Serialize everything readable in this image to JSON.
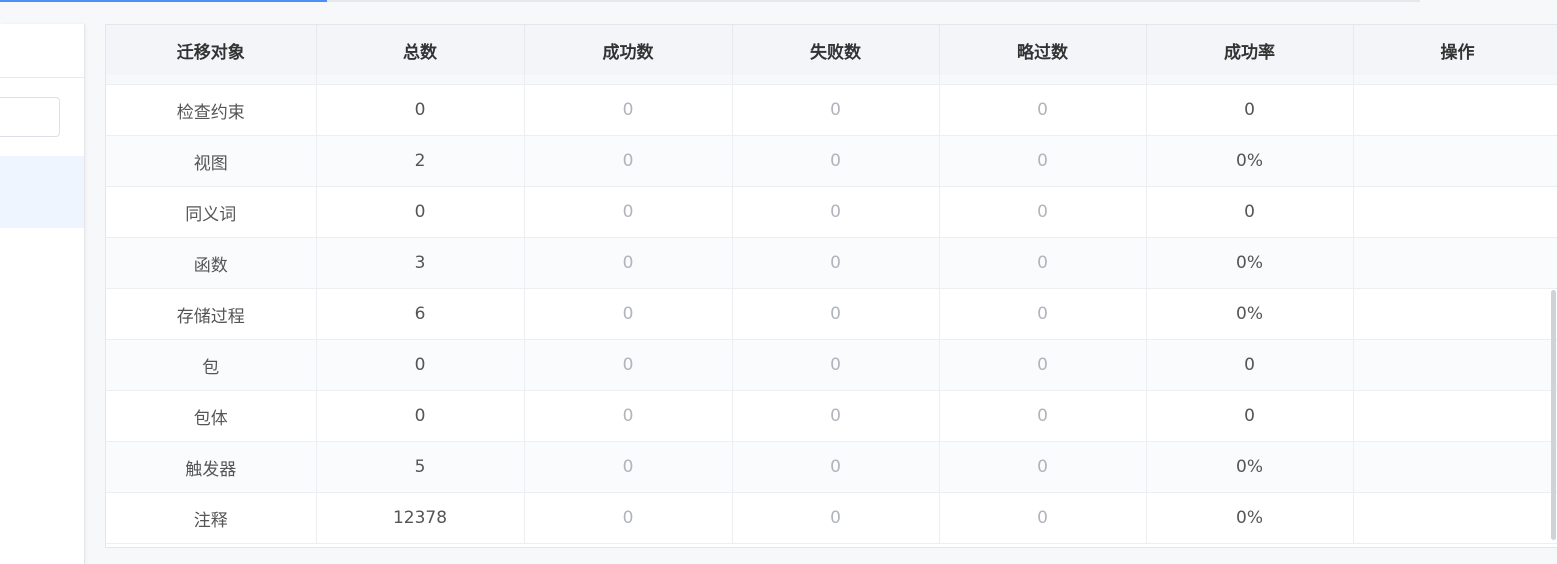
{
  "progress": 0.23,
  "table": {
    "headers": [
      "迁移对象",
      "总数",
      "成功数",
      "失败数",
      "略过数",
      "成功率",
      "操作"
    ],
    "rows": [
      {
        "object": "检查约束",
        "total": "0",
        "success": "0",
        "failed": "0",
        "skipped": "0",
        "rate": "0",
        "action": ""
      },
      {
        "object": "视图",
        "total": "2",
        "success": "0",
        "failed": "0",
        "skipped": "0",
        "rate": "0%",
        "action": ""
      },
      {
        "object": "同义词",
        "total": "0",
        "success": "0",
        "failed": "0",
        "skipped": "0",
        "rate": "0",
        "action": ""
      },
      {
        "object": "函数",
        "total": "3",
        "success": "0",
        "failed": "0",
        "skipped": "0",
        "rate": "0%",
        "action": ""
      },
      {
        "object": "存储过程",
        "total": "6",
        "success": "0",
        "failed": "0",
        "skipped": "0",
        "rate": "0%",
        "action": ""
      },
      {
        "object": "包",
        "total": "0",
        "success": "0",
        "failed": "0",
        "skipped": "0",
        "rate": "0",
        "action": ""
      },
      {
        "object": "包体",
        "total": "0",
        "success": "0",
        "failed": "0",
        "skipped": "0",
        "rate": "0",
        "action": ""
      },
      {
        "object": "触发器",
        "total": "5",
        "success": "0",
        "failed": "0",
        "skipped": "0",
        "rate": "0%",
        "action": ""
      },
      {
        "object": "注释",
        "total": "12378",
        "success": "0",
        "failed": "0",
        "skipped": "0",
        "rate": "0%",
        "action": ""
      }
    ]
  }
}
